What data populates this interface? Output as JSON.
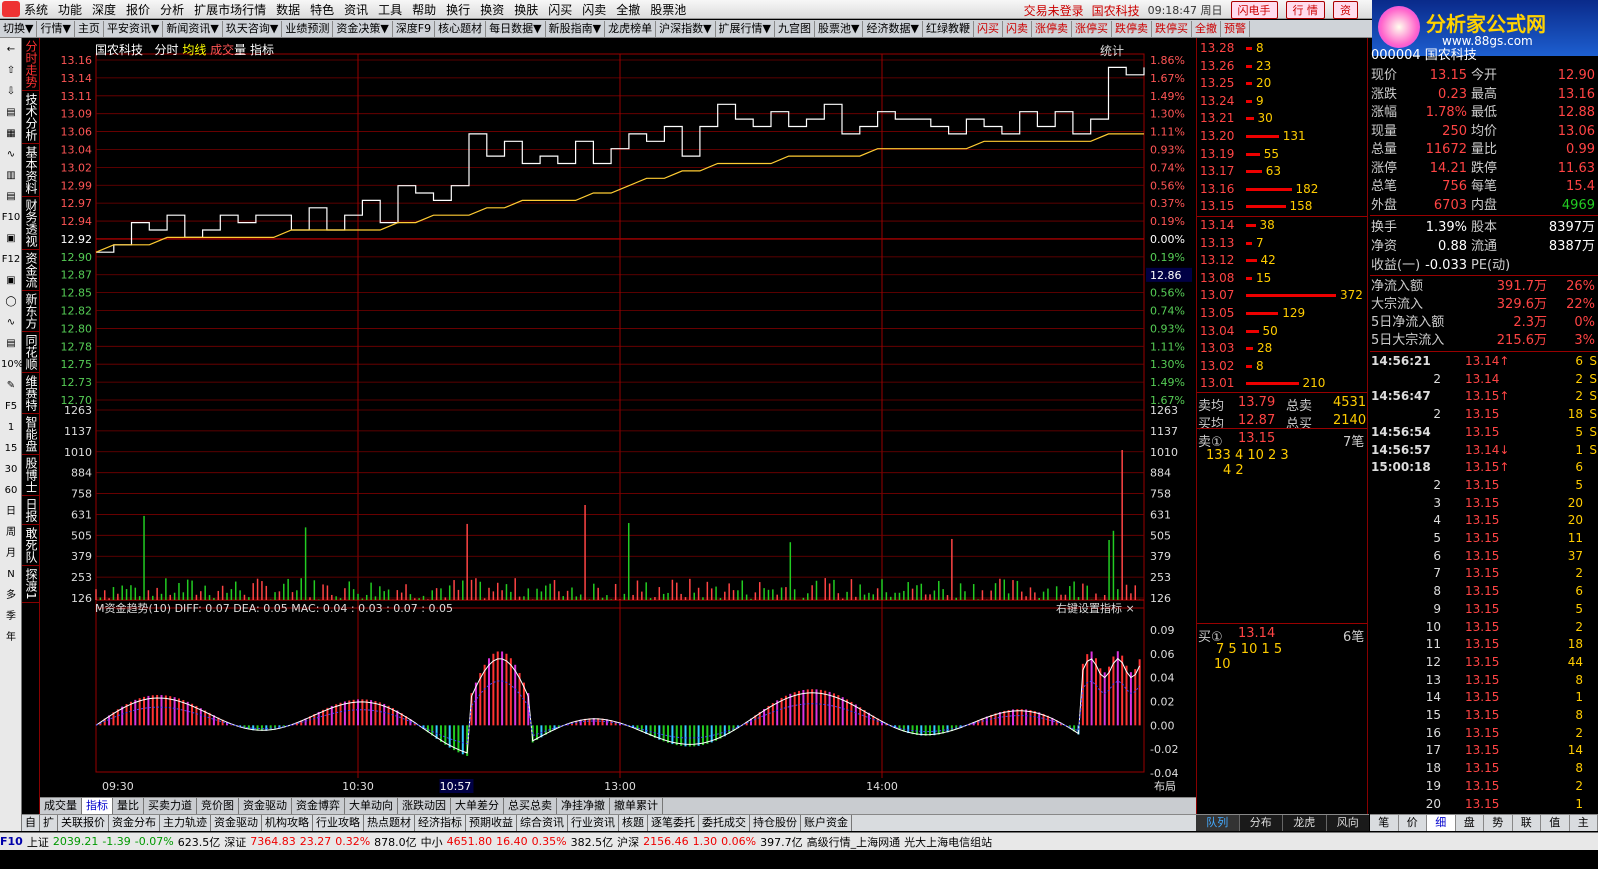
{
  "menu": [
    "系统",
    "功能",
    "深度",
    "报价",
    "分析",
    "扩展市场行情",
    "数据",
    "特色",
    "资讯",
    "工具",
    "帮助",
    "换行",
    "换资",
    "换肤",
    "闪买",
    "闪卖",
    "全撤",
    "股票池"
  ],
  "menu_status": {
    "login": "交易未登录",
    "stock": "国农科技",
    "time": "09:18:47 周日",
    "btn1": "闪电手",
    "btn2": "行 情",
    "btn3": "资"
  },
  "logo": {
    "title": "分析家公式网",
    "url": "www.88gs.com"
  },
  "toolbar": [
    "切换▼",
    "行情▼",
    "主页",
    "平安资讯▼",
    "新闻资讯▼",
    "玖天咨询▼",
    "业绩预测",
    "资金决策▼",
    "深度F9",
    "核心题材",
    "每日数据▼",
    "新股指南▼",
    "龙虎榜单",
    "沪深指数▼",
    "扩展行情▼",
    "九宫图",
    "股票池▼",
    "经济数据▼",
    "红绿教鞭",
    "闪买",
    "闪卖",
    "涨停卖",
    "涨停买",
    "跌停卖",
    "跌停买",
    "全撤",
    "预警"
  ],
  "left_icons": [
    "←",
    "⇧",
    "⇩",
    "▤",
    "▦",
    "∿",
    "▥",
    "▤",
    "F10",
    "▣",
    "F12",
    "▣",
    "◯",
    "∿",
    "▤",
    "10%",
    "✎",
    "F5",
    "1",
    "15",
    "30",
    "60",
    "日",
    "周",
    "月",
    "N",
    "多",
    "季",
    "年"
  ],
  "left_tabs": [
    "分时走势",
    "技术分析",
    "基本资料",
    "财务透视",
    "资金流",
    "新东方",
    "同花顺",
    "维赛特",
    "智能盘",
    "股博士",
    "日报",
    "敢死队",
    "探渡1"
  ],
  "chart": {
    "title_stock": "国农科技",
    "title_items": [
      "分时",
      "均线",
      "成交",
      "量",
      "指标"
    ],
    "stat": "统计",
    "price_labels": [
      "13.16",
      "13.14",
      "13.11",
      "13.09",
      "13.06",
      "13.04",
      "13.02",
      "12.99",
      "12.97",
      "12.94",
      "12.92",
      "12.90",
      "12.87",
      "12.85",
      "12.82",
      "12.80",
      "12.78",
      "12.75",
      "12.73",
      "12.70"
    ],
    "pct_labels": [
      "1.86%",
      "1.67%",
      "1.49%",
      "1.30%",
      "1.11%",
      "0.93%",
      "0.74%",
      "0.56%",
      "0.37%",
      "0.19%",
      "0.00%",
      "0.19%",
      "0.37%",
      "0.56%",
      "0.74%",
      "0.93%",
      "1.11%",
      "1.30%",
      "1.49%",
      "1.67%"
    ],
    "current_price_tag": "12.86",
    "vol_labels": [
      "1263",
      "1137",
      "1010",
      "884",
      "758",
      "631",
      "505",
      "379",
      "253",
      "126"
    ],
    "osc_title": "M资金趋势(10)  DIFF: 0.07  DEA: 0.05  MAC: 0.04  : 0.03  : 0.07  : 0.05",
    "osc_right": "右键设置指标 ×",
    "osc_labels": [
      "0.09",
      "0.06",
      "0.04",
      "0.02",
      "0.00",
      "-0.02",
      "-0.04"
    ],
    "time_labels": [
      "09:30",
      "10:30",
      "10:57",
      "13:00",
      "14:00"
    ],
    "layout_label": "布局"
  },
  "chart_data": {
    "type": "line",
    "title": "国农科技 分时",
    "ylim": [
      12.7,
      13.16
    ],
    "prev_close": 12.92,
    "series": [
      {
        "name": "price",
        "values": [
          12.9,
          12.91,
          12.94,
          12.93,
          12.95,
          12.92,
          12.93,
          12.95,
          12.94,
          12.95,
          12.95,
          12.93,
          12.96,
          12.93,
          12.95,
          12.97,
          12.94,
          12.99,
          12.98,
          12.97,
          12.99,
          13.06,
          13.03,
          13.05,
          13.02,
          13.03,
          13.02,
          13.05,
          13.02,
          13.04,
          13.06,
          13.05,
          13.07,
          13.03,
          13.07,
          13.1,
          13.08,
          13.07,
          13.09,
          13.07,
          13.08,
          13.1,
          13.06,
          13.07,
          13.09,
          13.08,
          13.08,
          13.07,
          13.06,
          13.08,
          13.07,
          13.06,
          13.09,
          13.07,
          13.09,
          13.06,
          13.08,
          13.15,
          13.14,
          13.15
        ]
      },
      {
        "name": "avg",
        "values": [
          12.9,
          12.91,
          12.91,
          12.91,
          12.92,
          12.92,
          12.92,
          12.92,
          12.92,
          12.92,
          12.92,
          12.93,
          12.93,
          12.93,
          12.93,
          12.93,
          12.93,
          12.94,
          12.94,
          12.95,
          12.95,
          12.95,
          12.96,
          12.96,
          12.97,
          12.97,
          12.97,
          12.97,
          12.98,
          12.98,
          12.99,
          13.0,
          13.0,
          13.01,
          13.01,
          13.02,
          13.02,
          13.02,
          13.02,
          13.03,
          13.03,
          13.03,
          13.03,
          13.03,
          13.04,
          13.04,
          13.04,
          13.04,
          13.04,
          13.04,
          13.05,
          13.05,
          13.05,
          13.05,
          13.05,
          13.05,
          13.05,
          13.06,
          13.06,
          13.06
        ]
      }
    ]
  },
  "orderbook_sell": [
    {
      "p": "13.28",
      "v": "8"
    },
    {
      "p": "13.26",
      "v": "23"
    },
    {
      "p": "13.25",
      "v": "20"
    },
    {
      "p": "13.24",
      "v": "9"
    },
    {
      "p": "13.21",
      "v": "30"
    },
    {
      "p": "13.20",
      "v": "131"
    },
    {
      "p": "13.19",
      "v": "55"
    },
    {
      "p": "13.17",
      "v": "63"
    },
    {
      "p": "13.16",
      "v": "182"
    },
    {
      "p": "13.15",
      "v": "158"
    }
  ],
  "orderbook_buy": [
    {
      "p": "13.14",
      "v": "38"
    },
    {
      "p": "13.13",
      "v": "7"
    },
    {
      "p": "13.12",
      "v": "42"
    },
    {
      "p": "13.08",
      "v": "15"
    },
    {
      "p": "13.07",
      "v": "372"
    },
    {
      "p": "13.05",
      "v": "129"
    },
    {
      "p": "13.04",
      "v": "50"
    },
    {
      "p": "13.03",
      "v": "28"
    },
    {
      "p": "13.02",
      "v": "8"
    },
    {
      "p": "13.01",
      "v": "210"
    }
  ],
  "ob_summary": {
    "sell_avg_k": "卖均",
    "sell_avg": "13.79",
    "sell_tot_k": "总卖",
    "sell_tot": "4531",
    "buy_avg_k": "买均",
    "buy_avg": "12.87",
    "buy_tot_k": "总买",
    "buy_tot": "2140"
  },
  "sell1": {
    "k": "卖①",
    "p": "13.15",
    "n": "7笔",
    "vols": "133   4   10   2   3",
    "vols2": "4   2"
  },
  "buy1": {
    "k": "买①",
    "p": "13.14",
    "n": "6笔",
    "vols": "7   5   10   1   5",
    "vols2": "10"
  },
  "quote_header": "000004 国农科技",
  "quote": [
    {
      "k": "现价",
      "v": "13.15",
      "k2": "今开",
      "v2": "12.90"
    },
    {
      "k": "涨跌",
      "v": "0.23",
      "k2": "最高",
      "v2": "13.16"
    },
    {
      "k": "涨幅",
      "v": "1.78%",
      "k2": "最低",
      "v2": "12.88"
    },
    {
      "k": "现量",
      "v": "250",
      "k2": "均价",
      "v2": "13.06"
    },
    {
      "k": "总量",
      "v": "11672",
      "k2": "量比",
      "v2": "0.99"
    },
    {
      "k": "涨停",
      "v": "14.21",
      "k2": "跌停",
      "v2": "11.63"
    },
    {
      "k": "总笔",
      "v": "756",
      "k2": "每笔",
      "v2": "15.4"
    },
    {
      "k": "外盘",
      "v": "6703",
      "k2": "内盘",
      "v2": "4969"
    }
  ],
  "quote2": [
    {
      "k": "换手",
      "v": "1.39%",
      "k2": "股本",
      "v2": "8397万"
    },
    {
      "k": "净资",
      "v": "0.88",
      "k2": "流通",
      "v2": "8387万"
    },
    {
      "k": "收益(一)",
      "v": "-0.033",
      "k2": "PE(动)",
      "v2": ""
    }
  ],
  "flows": [
    {
      "k": "净流入额",
      "v": "391.7万",
      "p": "26%"
    },
    {
      "k": "大宗流入",
      "v": "329.6万",
      "p": "22%"
    },
    {
      "k": "5日净流入额",
      "v": "2.3万",
      "p": "0%"
    },
    {
      "k": "5日大宗流入",
      "v": "215.6万",
      "p": "3%"
    }
  ],
  "ticks": [
    {
      "t": "14:56:21",
      "p": "13.14↑",
      "v": "6",
      "bs": "S"
    },
    {
      "t": "2",
      "p": "13.14",
      "v": "2",
      "bs": "S"
    },
    {
      "t": "14:56:47",
      "p": "13.15↑",
      "v": "2",
      "bs": "S"
    },
    {
      "t": "2",
      "p": "13.15",
      "v": "18",
      "bs": "S"
    },
    {
      "t": "14:56:54",
      "p": "13.15",
      "v": "5",
      "bs": "S"
    },
    {
      "t": "14:56:57",
      "p": "13.14↓",
      "v": "1",
      "bs": "S"
    },
    {
      "t": "15:00:18",
      "p": "13.15↑",
      "v": "6",
      "bs": ""
    },
    {
      "t": "2",
      "p": "13.15",
      "v": "5",
      "bs": ""
    },
    {
      "t": "3",
      "p": "13.15",
      "v": "20",
      "bs": ""
    },
    {
      "t": "4",
      "p": "13.15",
      "v": "20",
      "bs": ""
    },
    {
      "t": "5",
      "p": "13.15",
      "v": "11",
      "bs": ""
    },
    {
      "t": "6",
      "p": "13.15",
      "v": "37",
      "bs": ""
    },
    {
      "t": "7",
      "p": "13.15",
      "v": "2",
      "bs": ""
    },
    {
      "t": "8",
      "p": "13.15",
      "v": "6",
      "bs": ""
    },
    {
      "t": "9",
      "p": "13.15",
      "v": "5",
      "bs": ""
    },
    {
      "t": "10",
      "p": "13.15",
      "v": "2",
      "bs": ""
    },
    {
      "t": "11",
      "p": "13.15",
      "v": "18",
      "bs": ""
    },
    {
      "t": "12",
      "p": "13.15",
      "v": "44",
      "bs": ""
    },
    {
      "t": "13",
      "p": "13.15",
      "v": "8",
      "bs": ""
    },
    {
      "t": "14",
      "p": "13.15",
      "v": "1",
      "bs": ""
    },
    {
      "t": "15",
      "p": "13.15",
      "v": "8",
      "bs": ""
    },
    {
      "t": "16",
      "p": "13.15",
      "v": "2",
      "bs": ""
    },
    {
      "t": "17",
      "p": "13.15",
      "v": "14",
      "bs": ""
    },
    {
      "t": "18",
      "p": "13.15",
      "v": "8",
      "bs": ""
    },
    {
      "t": "19",
      "p": "13.15",
      "v": "2",
      "bs": ""
    },
    {
      "t": "20",
      "p": "13.15",
      "v": "1",
      "bs": ""
    }
  ],
  "bottom_tabs1": [
    "成交量",
    "指标",
    "量比",
    "买卖力道",
    "竞价图",
    "资金驱动",
    "资金博弈",
    "大单动向",
    "涨跌动因",
    "大单差分",
    "总买总卖",
    "净挂净撤",
    "撤单累计"
  ],
  "bottom_tabs2": [
    "自",
    "扩",
    "关联报价",
    "资金分布",
    "主力轨迹",
    "资金驱动",
    "机构攻略",
    "行业攻略",
    "热点题材",
    "经济指标",
    "预期收益",
    "综合资讯",
    "行业资讯",
    "核题",
    "逐笔委托",
    "委托成交",
    "持仓股份",
    "账户资金"
  ],
  "mid_tabs": [
    "队列",
    "分布",
    "龙虎",
    "风向"
  ],
  "right_tabs": [
    "笔",
    "价",
    "细",
    "盘",
    "势",
    "联",
    "值",
    "主"
  ],
  "status": {
    "f10": "F10",
    "sh_k": "上证",
    "sh": "2039.21",
    "sh_c": "-1.39",
    "sh_p": "-0.07%",
    "sh_a": "623.5亿",
    "sz_k": "深证",
    "sz": "7364.83",
    "sz_c": "23.27",
    "sz_p": "0.32%",
    "sz_a": "878.0亿",
    "zx_k": "中小",
    "zx": "4651.80",
    "zx_c": "16.40",
    "zx_p": "0.35%",
    "zx_a": "382.5亿",
    "hs_k": "沪深",
    "hs": "2156.46",
    "hs_c": "1.30",
    "hs_p": "0.06%",
    "hs_a": "397.7亿",
    "net1": "高级行情_上海网通",
    "net2": "光大上海电信组站"
  }
}
